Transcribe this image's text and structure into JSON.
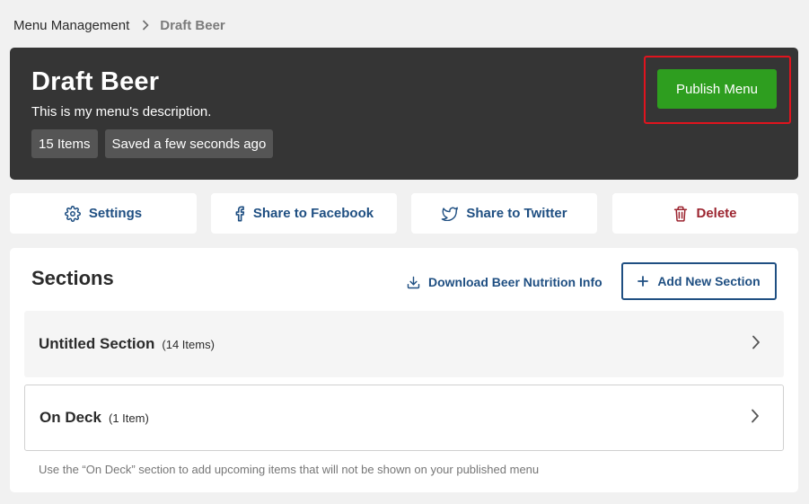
{
  "breadcrumb": {
    "parent": "Menu Management",
    "current": "Draft Beer"
  },
  "header": {
    "title": "Draft Beer",
    "description": "This is my menu's description.",
    "badges": [
      "15 Items",
      "Saved a few seconds ago"
    ],
    "publish_label": "Publish Menu"
  },
  "actions": {
    "settings": "Settings",
    "facebook": "Share to Facebook",
    "twitter": "Share to Twitter",
    "delete": "Delete"
  },
  "sections": {
    "title": "Sections",
    "download_label": "Download Beer Nutrition Info",
    "add_label": "Add New Section",
    "items": [
      {
        "name": "Untitled Section",
        "count": "(14 Items)"
      },
      {
        "name": "On Deck",
        "count": "(1 Item)"
      }
    ],
    "note": "Use the “On Deck” section to add upcoming items that will not be shown on your published menu"
  },
  "colors": {
    "header_bg": "#353535",
    "publish_green": "#2e9e1f",
    "highlight_red": "#e0141e",
    "link_blue": "#1f4f82",
    "delete_red": "#9c2530"
  },
  "icons": {
    "breadcrumb_separator": "chevron-right-icon",
    "settings": "gear-icon",
    "facebook": "facebook-icon",
    "twitter": "twitter-icon",
    "delete": "trash-icon",
    "download": "download-icon",
    "add": "plus-icon",
    "row": "chevron-right-icon"
  }
}
